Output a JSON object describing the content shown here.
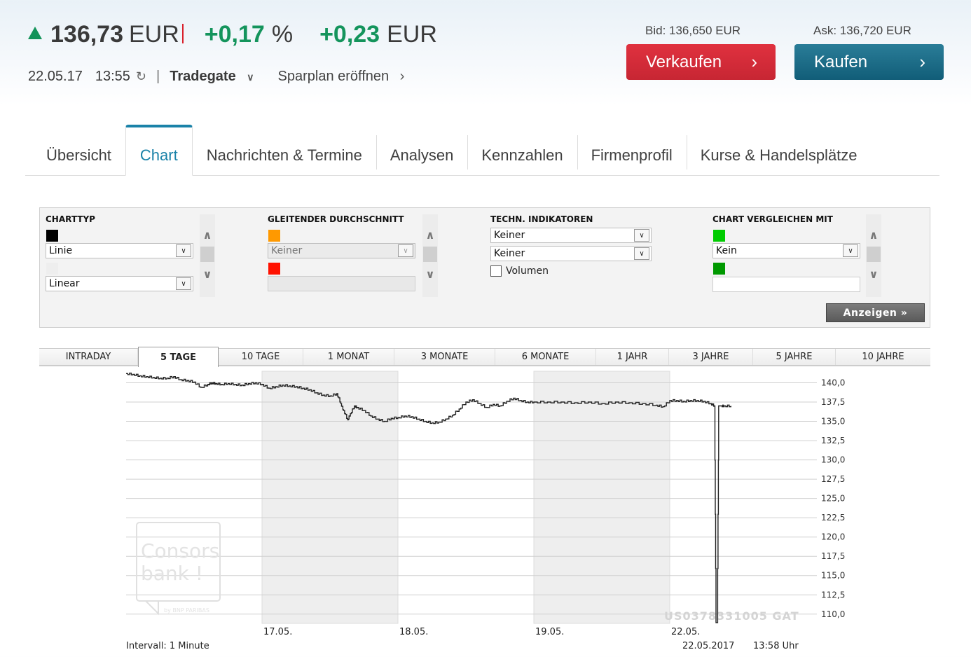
{
  "quote": {
    "trend_icon": "triangle-up-icon",
    "price": "136,73",
    "price_unit": "EUR",
    "change_pct": "+0,17",
    "change_pct_unit": "%",
    "change_abs": "+0,23",
    "change_abs_unit": "EUR",
    "date": "22.05.17",
    "time": "13:55",
    "refresh_icon": "refresh-icon",
    "separator": "|",
    "exchange": "Tradegate",
    "savings_plan_link": "Sparplan eröffnen",
    "colors": {
      "positive": "#14945c",
      "sell": "#d42b38",
      "buy": "#17678a",
      "accent": "#1a82a8"
    }
  },
  "trade": {
    "bid_label": "Bid: 136,650 EUR",
    "ask_label": "Ask: 136,720 EUR",
    "sell_label": "Verkaufen",
    "buy_label": "Kaufen"
  },
  "tabs": [
    {
      "label": "Übersicht",
      "active": false
    },
    {
      "label": "Chart",
      "active": true
    },
    {
      "label": "Nachrichten & Termine",
      "active": false
    },
    {
      "label": "Analysen",
      "active": false
    },
    {
      "label": "Kennzahlen",
      "active": false
    },
    {
      "label": "Firmenprofil",
      "active": false
    },
    {
      "label": "Kurse & Handelsplätze",
      "active": false
    }
  ],
  "settings": {
    "charttype": {
      "title": "CHARTTYP",
      "color1": "#000000",
      "type_value": "Linie",
      "color2": "#eeeeee",
      "scale_value": "Linear"
    },
    "moving_average": {
      "title": "GLEITENDER DURCHSCHNITT",
      "color1": "#ff9900",
      "value": "Keiner",
      "color2": "#ff1100",
      "input_value": ""
    },
    "indicators": {
      "title": "TECHN. INDIKATOREN",
      "value1": "Keiner",
      "value2": "Keiner",
      "volume_label": "Volumen",
      "volume_checked": false
    },
    "compare": {
      "title": "CHART VERGLEICHEN MIT",
      "color1": "#00cc00",
      "value": "Kein",
      "color2": "#009900",
      "input_value": ""
    },
    "show_button": "Anzeigen »"
  },
  "periods": [
    {
      "label": "INTRADAY",
      "active": false
    },
    {
      "label": "5 TAGE",
      "active": true
    },
    {
      "label": "10 TAGE",
      "active": false
    },
    {
      "label": "1 MONAT",
      "active": false
    },
    {
      "label": "3 MONATE",
      "active": false
    },
    {
      "label": "6 MONATE",
      "active": false
    },
    {
      "label": "1 JAHR",
      "active": false
    },
    {
      "label": "3 JAHRE",
      "active": false
    },
    {
      "label": "5 JAHRE",
      "active": false
    },
    {
      "label": "10 JAHRE",
      "active": false
    }
  ],
  "chart_data": {
    "type": "line",
    "title": "",
    "xlabel": "",
    "ylabel": "",
    "ylim": [
      108.8,
      141.5
    ],
    "y_ticks": [
      "140,0",
      "137,5",
      "135,0",
      "132,5",
      "130,0",
      "127,5",
      "125,0",
      "122,5",
      "120,0",
      "117,5",
      "115,0",
      "112,5",
      "110,0"
    ],
    "y_tick_values": [
      140,
      137.5,
      135,
      132.5,
      130,
      127.5,
      125,
      122.5,
      120,
      117.5,
      115,
      112.5,
      110
    ],
    "x_ticks": [
      "17.05.",
      "18.05.",
      "19.05.",
      "22.05."
    ],
    "x_range_days": [
      0,
      4.9
    ],
    "x_tick_positions_days": [
      1,
      2,
      3,
      4
    ],
    "shaded_days": [
      [
        1,
        2
      ],
      [
        3,
        4
      ]
    ],
    "grid": true,
    "legend": "none",
    "interval_label": "Intervall: 1 Minute",
    "timestamp_label": "22.05.2017",
    "time_label": "13:58 Uhr",
    "watermark_id": "US0378331005 GAT",
    "watermark_logo": {
      "line1": "Consors",
      "line2": "bank !",
      "line3": "by BNP PARIBAS"
    },
    "series": [
      {
        "name": "Price",
        "x": [
          0.0,
          0.05,
          0.1,
          0.15,
          0.2,
          0.25,
          0.3,
          0.35,
          0.4,
          0.45,
          0.5,
          0.55,
          0.6,
          0.63,
          0.66,
          0.7,
          0.75,
          0.8,
          0.85,
          0.9,
          0.95,
          1.0,
          1.05,
          1.1,
          1.15,
          1.2,
          1.25,
          1.3,
          1.35,
          1.4,
          1.45,
          1.5,
          1.55,
          1.58,
          1.6,
          1.63,
          1.65,
          1.68,
          1.7,
          1.75,
          1.8,
          1.85,
          1.9,
          1.95,
          2.0,
          2.05,
          2.1,
          2.15,
          2.2,
          2.25,
          2.3,
          2.35,
          2.4,
          2.45,
          2.5,
          2.55,
          2.6,
          2.65,
          2.7,
          2.75,
          2.8,
          2.85,
          2.9,
          2.95,
          3.0,
          3.1,
          3.2,
          3.3,
          3.4,
          3.5,
          3.6,
          3.7,
          3.8,
          3.9,
          3.95,
          4.0,
          4.05,
          4.1,
          4.15,
          4.2,
          4.25,
          4.3,
          4.33,
          4.34,
          4.35,
          4.36,
          4.37,
          4.38,
          4.4,
          4.45
        ],
        "values": [
          141.2,
          141.1,
          140.9,
          140.8,
          140.7,
          140.6,
          140.6,
          140.8,
          140.4,
          140.3,
          140.1,
          139.4,
          139.8,
          140.0,
          139.9,
          139.8,
          139.9,
          139.8,
          139.7,
          139.9,
          140.0,
          139.8,
          139.3,
          139.5,
          139.7,
          139.6,
          139.5,
          139.3,
          139.1,
          138.7,
          138.4,
          138.3,
          138.6,
          137.3,
          136.4,
          135.2,
          136.0,
          137.0,
          136.8,
          136.4,
          135.7,
          135.3,
          135.0,
          135.4,
          135.5,
          135.7,
          135.6,
          135.3,
          135.0,
          134.8,
          134.9,
          135.3,
          135.8,
          136.6,
          137.5,
          137.8,
          137.3,
          136.8,
          137.2,
          137.0,
          137.6,
          138.0,
          137.7,
          137.5,
          137.5,
          137.5,
          137.5,
          137.4,
          137.5,
          137.3,
          137.5,
          137.4,
          137.3,
          137.1,
          136.9,
          137.7,
          137.7,
          137.6,
          137.7,
          137.7,
          137.6,
          137.3,
          137.0,
          108.9,
          108.9,
          137.0,
          137.0,
          137.0,
          137.0,
          137.0
        ]
      }
    ]
  }
}
